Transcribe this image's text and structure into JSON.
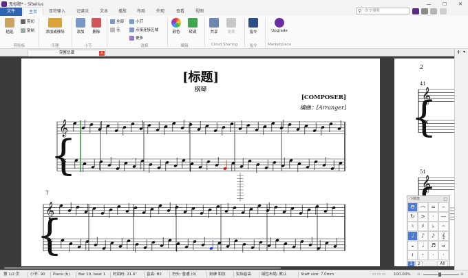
{
  "window": {
    "title": "无标题* - Sibelius",
    "min": "—",
    "max": "☐",
    "close": "✕"
  },
  "tabs": [
    "文件",
    "主页",
    "音符输入",
    "记谱法",
    "文本",
    "播放",
    "布局",
    "外观",
    "查看",
    "视图"
  ],
  "search": {
    "placeholder": "命令搜索"
  },
  "ribbon": {
    "clipboard": {
      "paste": "粘贴",
      "cut": "剪切",
      "copy": "复制",
      "group": "剪贴板"
    },
    "instruments": {
      "add_remove": "添加或移除",
      "group": "乐器"
    },
    "bars": {
      "add": "添加",
      "delete": "删除",
      "group": "小节"
    },
    "selection": {
      "all": "全部",
      "bar": "小节",
      "none": "无",
      "passage": "点接连接区域",
      "more": "更多",
      "group": "选择"
    },
    "edit": {
      "color": "颜色",
      "transpose": "转调",
      "group": "编辑"
    },
    "cloud": {
      "share": "共享",
      "publish": "发表",
      "group": "Cloud Sharing"
    },
    "command": {
      "label": "指令",
      "group": "指令"
    },
    "marketplace": {
      "upgrade": "Upgrade",
      "group": "Marketplace"
    }
  },
  "document_tab": {
    "label": "完整总谱",
    "close": "x"
  },
  "score": {
    "title": "[标题]",
    "instrument": "钢琴",
    "composer": "[COMPOSER]",
    "arranger": "编曲：[Arranger]",
    "system2_bar": "7",
    "page2_number": "2",
    "page2_bar1": "41",
    "page2_bar2": "51"
  },
  "right_strip": {
    "plus": "+",
    "arrow": "▾"
  },
  "keypad": {
    "title": "小键盘",
    "close": "□",
    "rows": [
      [
        "⊖",
        "—",
        "=",
        "⌢"
      ],
      [
        "↻",
        ">",
        "·",
        "—"
      ],
      [
        "♮",
        "♯",
        "♭",
        "𝄐"
      ],
      [
        "♩",
        "♪",
        "𝅘𝅥𝅯",
        "𝄞"
      ],
      [
        "𝅝",
        "𝅗𝅥",
        "♬",
        "𝄪"
      ],
      [
        "𝄽",
        "𝄾",
        "·",
        "·"
      ]
    ],
    "layouts": [
      "1",
      "2"
    ],
    "all": "All"
  },
  "status": {
    "page": "第 1/2 页",
    "bars": "小节: 90",
    "instrument": "Piano (b)",
    "position": "Bar 10, beat 1",
    "timecode": "时间码: 21.6\"",
    "pitch": "音高: B2",
    "voice": "符头: 普通 (0)",
    "transposing": "刻谱 和弦",
    "concert": "实际音高",
    "layout": "磁性布局: 默认",
    "staff_size": "Staff size: 7.0mm",
    "zoom": "100.00%"
  },
  "colors": {
    "accent": "#2f63b4",
    "selection_green": "#1d8a2e",
    "selected_note_red": "#d01010",
    "selected_note_blue": "#2230d8"
  }
}
